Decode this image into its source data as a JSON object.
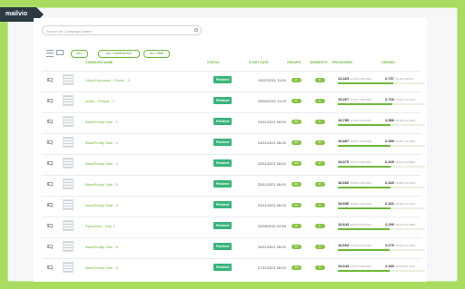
{
  "brand": "mailvio",
  "search_placeholder": "Search for Campaign Name",
  "filters": [
    "ALL",
    "ALL CAMPAIGNS",
    "ALL TIME"
  ],
  "columns": {
    "name": "CAMPAIGN NAME",
    "status": "STATUS",
    "start_date": "START DATE",
    "groups": "GROUPS",
    "segments": "SEGMENTS",
    "processed": "PROCESSED",
    "opened": "OPENED"
  },
  "rows": [
    {
      "name": "VideoProposals - Christ... 3",
      "status": "Finished",
      "date": "10/07/2021 11:00",
      "groups": "2",
      "segments": "0",
      "processed": "13,323",
      "processed_pct": "13,323 (100.00%)",
      "opened": "2,737",
      "opened_pct": "13,323 (20.5%)",
      "processed_ratio": 1.0,
      "opened_ratio": 0.205
    },
    {
      "name": "kGain - Presell - 1",
      "status": "Finished",
      "date": "25/04/2021 11:00",
      "groups": "8",
      "segments": "0",
      "processed": "15,267",
      "processed_pct": "15,267 (100.00%)",
      "opened": "2,726",
      "opened_pct": "15,267 (17.84%)",
      "processed_ratio": 1.0,
      "opened_ratio": 0.178
    },
    {
      "name": "BlackFriday Sale - 1",
      "status": "Finished",
      "date": "23/11/2021 06:00",
      "groups": "14",
      "segments": "0",
      "processed": "18,789",
      "processed_pct": "18,789 (100.00%)",
      "opened": "2,586",
      "opened_pct": "18,789 (13.76%)",
      "processed_ratio": 1.0,
      "opened_ratio": 0.138
    },
    {
      "name": "BlackFriday Sale - 2",
      "status": "Finished",
      "date": "24/11/2021 06:00",
      "groups": "14",
      "segments": "0",
      "processed": "18,687",
      "processed_pct": "18,687 (100.00%)",
      "opened": "2,380",
      "opened_pct": "18,687 (12.74%)",
      "processed_ratio": 1.0,
      "opened_ratio": 0.127
    },
    {
      "name": "BlackFriday Sale - 4",
      "status": "Finished",
      "date": "25/11/2021 06:00",
      "groups": "14",
      "segments": "0",
      "processed": "18,675",
      "processed_pct": "18,675 (100.00%)",
      "opened": "2,349",
      "opened_pct": "18,675 (12.58%)",
      "processed_ratio": 1.0,
      "opened_ratio": 0.126
    },
    {
      "name": "BlackFriday Sale - 5",
      "status": "Finished",
      "date": "25/11/2021 06:00",
      "groups": "14",
      "segments": "0",
      "processed": "18,666",
      "processed_pct": "18,666 (100.00%)",
      "opened": "2,340",
      "opened_pct": "18,666 (12.54%)",
      "processed_ratio": 1.0,
      "opened_ratio": 0.125
    },
    {
      "name": "BlackFriday Sale - 3",
      "status": "Finished",
      "date": "24/11/2021 06:00",
      "groups": "14",
      "segments": "0",
      "processed": "18,696",
      "processed_pct": "18,696 (100.00%)",
      "opened": "2,331",
      "opened_pct": "18,696 (12.47%)",
      "processed_ratio": 1.0,
      "opened_ratio": 0.125
    },
    {
      "name": "Eyeschets - Day 2",
      "status": "Finished",
      "date": "20/09/2021 09:53",
      "groups": "11",
      "segments": "0",
      "processed": "18,643",
      "processed_pct": "18,643 (100.00%)",
      "opened": "2,290",
      "opened_pct": "18,643 (12.28%)",
      "processed_ratio": 1.0,
      "opened_ratio": 0.123
    },
    {
      "name": "BlackFriday Sale - 6",
      "status": "Finished",
      "date": "26/11/2021 06:00",
      "groups": "14",
      "segments": "0",
      "processed": "18,663",
      "processed_pct": "18,663 (100.00%)",
      "opened": "2,276",
      "opened_pct": "18,663 (12.20%)",
      "processed_ratio": 1.0,
      "opened_ratio": 0.122
    },
    {
      "name": "BlackFriday Sale - 8",
      "status": "Finished",
      "date": "27/11/2021 06:00",
      "groups": "14",
      "segments": "0",
      "processed": "18,643",
      "processed_pct": "18,643 (100.00%)",
      "opened": "2,183",
      "opened_pct": "18,643 (11.71%)",
      "processed_ratio": 1.0,
      "opened_ratio": 0.117
    }
  ]
}
